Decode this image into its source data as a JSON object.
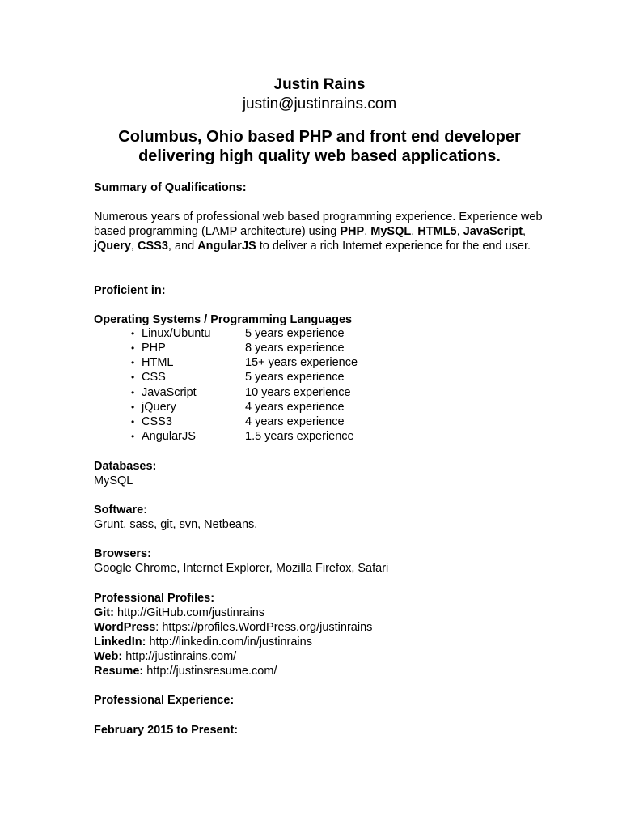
{
  "header": {
    "name": "Justin Rains",
    "email": "justin@justinrains.com",
    "tagline_line1": "Columbus, Ohio based PHP and front end developer",
    "tagline_line2": "delivering high quality web based applications."
  },
  "summary": {
    "heading": "Summary of Qualifications:",
    "text_1": "Numerous years of professional web based programming experience. Experience web based programming (LAMP architecture) using ",
    "php": "PHP",
    "sep_1": ", ",
    "mysql": "MySQL",
    "sep_2": ", ",
    "html5": "HTML5",
    "sep_3": ", ",
    "javascript": "JavaScript",
    "sep_4": ", ",
    "jquery": "jQuery",
    "sep_5": ", ",
    "css3": "CSS3",
    "sep_6": ", and ",
    "angularjs": "AngularJS",
    "text_2": " to deliver a rich Internet experience for the end user."
  },
  "proficient": {
    "heading": "Proficient in:"
  },
  "os_languages": {
    "heading": "Operating Systems / Programming Languages",
    "items": [
      {
        "bullet": "•",
        "name": "Linux/Ubuntu",
        "experience": "5 years experience"
      },
      {
        "bullet": "•",
        "name": "PHP",
        "experience": "8 years experience"
      },
      {
        "bullet": "•",
        "name": "HTML",
        "experience": "15+ years experience"
      },
      {
        "bullet": "•",
        "name": "CSS",
        "experience": "5 years experience"
      },
      {
        "bullet": "•",
        "name": "JavaScript",
        "experience": "10 years experience"
      },
      {
        "bullet": "•",
        "name": "jQuery",
        "experience": "4 years experience"
      },
      {
        "bullet": "•",
        "name": "CSS3",
        "experience": "4 years experience"
      },
      {
        "bullet": "•",
        "name": "AngularJS",
        "experience": "1.5 years experience"
      }
    ]
  },
  "databases": {
    "heading": "Databases:",
    "value": "MySQL"
  },
  "software": {
    "heading": "Software:",
    "value": "Grunt, sass, git, svn, Netbeans."
  },
  "browsers": {
    "heading": "Browsers:",
    "value": "Google Chrome, Internet Explorer, Mozilla Firefox, Safari"
  },
  "profiles": {
    "heading": "Professional Profiles:",
    "items": [
      {
        "label": "Git:",
        "url": " http://GitHub.com/justinrains"
      },
      {
        "label": "WordPress",
        "url": ": https://profiles.WordPress.org/justinrains"
      },
      {
        "label": "LinkedIn:",
        "url": " http://linkedin.com/in/justinrains"
      },
      {
        "label": "Web:",
        "url": " http://justinrains.com/"
      },
      {
        "label": "Resume:",
        "url": " http://justinsresume.com/"
      }
    ]
  },
  "experience": {
    "heading": "Professional Experience:",
    "period": "February 2015 to Present:"
  }
}
